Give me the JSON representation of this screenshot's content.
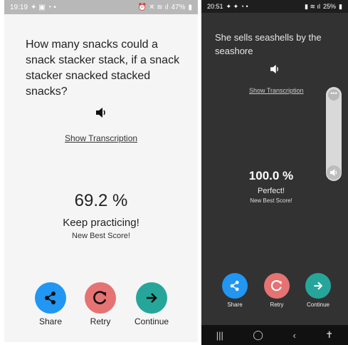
{
  "left": {
    "status": {
      "time": "19:19",
      "battery": "47%"
    },
    "question": "How many snacks could a snack stacker stack, if a snack stacker snacked stacked snacks?",
    "show_transcription": "Show Transcription",
    "score": "69.2 %",
    "feedback": "Keep practicing!",
    "best": "New Best Score!",
    "actions": [
      {
        "label": "Share",
        "color": "#2196f3",
        "icon": "share-icon"
      },
      {
        "label": "Retry",
        "color": "#e57373",
        "icon": "retry-icon"
      },
      {
        "label": "Continue",
        "color": "#26a69a",
        "icon": "arrow-right-icon"
      }
    ]
  },
  "right": {
    "status": {
      "time": "20:51",
      "battery": "25%"
    },
    "question": "She sells seashells by the seashore",
    "show_transcription": "Show Transcription",
    "score": "100.0 %",
    "feedback": "Perfect!",
    "best": "New Best Score!",
    "actions": [
      {
        "label": "Share",
        "color": "#2196f3",
        "icon": "share-icon"
      },
      {
        "label": "Retry",
        "color": "#e57373",
        "icon": "retry-icon"
      },
      {
        "label": "Continue",
        "color": "#26a69a",
        "icon": "arrow-right-icon"
      }
    ],
    "volume_dots": "•••"
  }
}
